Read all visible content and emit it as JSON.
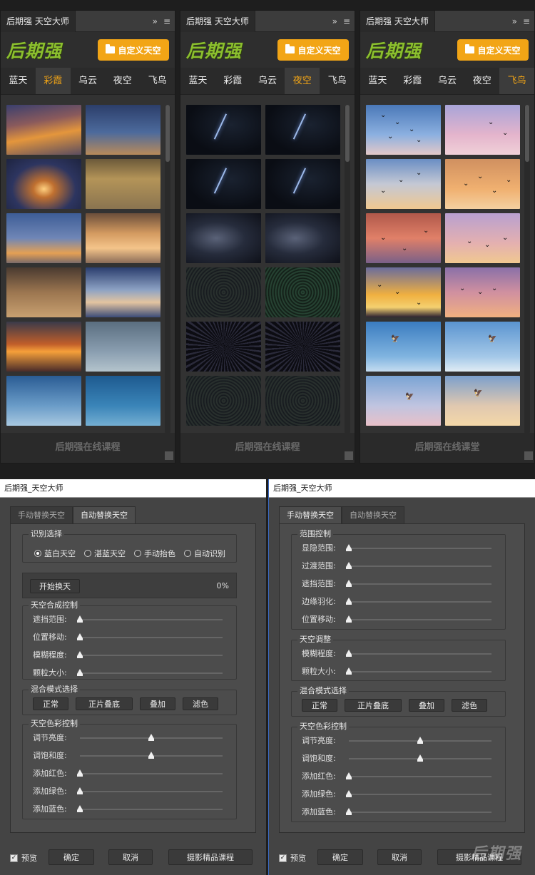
{
  "panels": [
    {
      "title": "后期强  天空大师",
      "logo": "后期强",
      "custom_button": "自定义天空",
      "tabs": [
        "蓝天",
        "彩霞",
        "乌云",
        "夜空",
        "飞鸟"
      ],
      "active_tab": 1,
      "footer": "后期强在线课程",
      "thumbs": [
        "sky-orange",
        "sky-dusk",
        "sky-sunburst",
        "sky-rays",
        "sky-blue-gold",
        "sky-peach",
        "sky-haze",
        "sky-rays-blue",
        "sky-sunset-red",
        "sky-rainbow-grey",
        "sky-rainbow-blue",
        "sky-blue-deep"
      ]
    },
    {
      "title": "后期强  天空大师",
      "logo": "后期强",
      "custom_button": "自定义天空",
      "tabs": [
        "蓝天",
        "彩霞",
        "乌云",
        "夜空",
        "飞鸟"
      ],
      "active_tab": 3,
      "footer": "后期强在线课程",
      "thumbs": [
        "lightning",
        "lightning",
        "lightning",
        "lightning",
        "milky",
        "milky",
        "swirl",
        "swirl-green",
        "starburst",
        "starburst",
        "swirl",
        "swirl"
      ]
    },
    {
      "title": "后期强  天空大师",
      "logo": "后期强",
      "custom_button": "自定义天空",
      "tabs": [
        "蓝天",
        "彩霞",
        "乌云",
        "夜空",
        "飞鸟"
      ],
      "active_tab": 4,
      "footer": "后期强在线课堂",
      "thumbs": [
        "sky-bird-blue",
        "sky-bird-pink",
        "sky-bird-sand",
        "sky-bird-peach",
        "sky-bird-red",
        "sky-bird-lavender",
        "sky-bird-gold",
        "sky-bird-violet",
        "sky-eagle-blue",
        "sky-eagle-light",
        "sky-eagle-pink",
        "sky-eagle-cream"
      ]
    }
  ],
  "title_controls": {
    "collapse": "»",
    "menu": "≡"
  },
  "dialog_auto": {
    "title": "后期强_天空大师",
    "tabs": [
      "手动替换天空",
      "自动替换天空"
    ],
    "active_tab": 1,
    "recognition": {
      "title": "识别选择",
      "options": [
        "蓝白天空",
        "湛蓝天空",
        "手动抬色",
        "自动识别"
      ],
      "selected": 0
    },
    "start_button": "开始换天",
    "progress": "0%",
    "compose": {
      "title": "天空合成控制",
      "sliders": [
        {
          "label": "遮挡范围:",
          "value": 0
        },
        {
          "label": "位置移动:",
          "value": 0
        },
        {
          "label": "模糊程度:",
          "value": 0
        },
        {
          "label": "颗粒大小:",
          "value": 0
        }
      ]
    },
    "blend": {
      "title": "混合模式选择",
      "buttons": [
        "正常",
        "正片叠底",
        "叠加",
        "滤色"
      ]
    },
    "color": {
      "title": "天空色彩控制",
      "sliders": [
        {
          "label": "调节亮度:",
          "value": 0.5
        },
        {
          "label": "调饱和度:",
          "value": 0.5
        },
        {
          "label": "添加红色:",
          "value": 0
        },
        {
          "label": "添加绿色:",
          "value": 0
        },
        {
          "label": "添加蓝色:",
          "value": 0
        }
      ]
    },
    "footer": {
      "preview": "预览",
      "ok": "确定",
      "cancel": "取消",
      "course": "摄影精品课程"
    }
  },
  "dialog_manual": {
    "title": "后期强_天空大师",
    "tabs": [
      "手动替换天空",
      "自动替换天空"
    ],
    "active_tab": 0,
    "range": {
      "title": "范围控制",
      "sliders": [
        {
          "label": "显隐范围:",
          "value": 0
        },
        {
          "label": "过渡范围:",
          "value": 0
        },
        {
          "label": "遮挡范围:",
          "value": 0
        },
        {
          "label": "边缘羽化:",
          "value": 0
        },
        {
          "label": "位置移动:",
          "value": 0
        }
      ]
    },
    "adjust": {
      "title": "天空调整",
      "sliders": [
        {
          "label": "模糊程度:",
          "value": 0
        },
        {
          "label": "颗粒大小:",
          "value": 0
        }
      ]
    },
    "blend": {
      "title": "混合模式选择",
      "buttons": [
        "正常",
        "正片叠底",
        "叠加",
        "滤色"
      ]
    },
    "color": {
      "title": "天空色彩控制",
      "sliders": [
        {
          "label": "调节亮度:",
          "value": 0.5
        },
        {
          "label": "调饱和度:",
          "value": 0.5
        },
        {
          "label": "添加红色:",
          "value": 0
        },
        {
          "label": "添加绿色:",
          "value": 0
        },
        {
          "label": "添加蓝色:",
          "value": 0
        }
      ]
    },
    "footer": {
      "preview": "预览",
      "ok": "确定",
      "cancel": "取消",
      "course": "摄影精品课程"
    },
    "watermark": "后期强"
  }
}
